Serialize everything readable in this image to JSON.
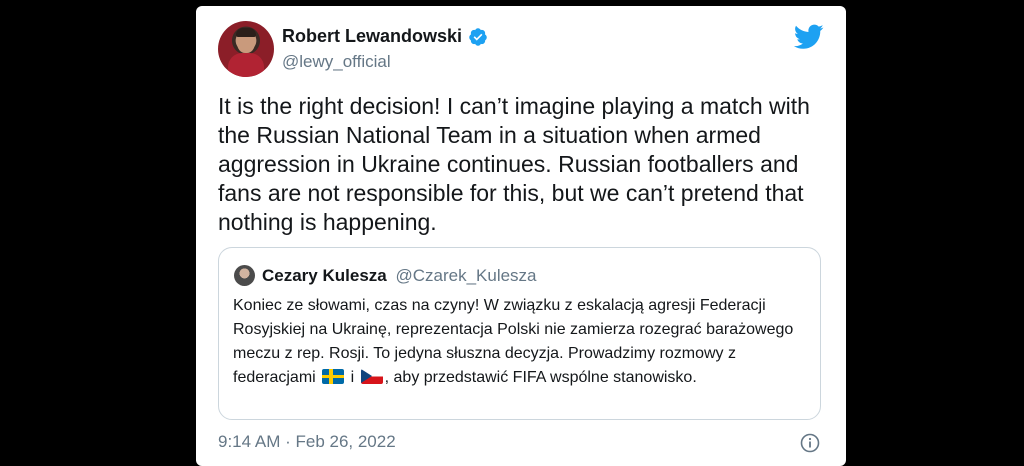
{
  "tweet": {
    "author_name": "Robert Lewandowski",
    "author_handle": "@lewy_official",
    "verified_icon": "verified-badge-icon",
    "brand_icon": "twitter-bird-icon",
    "text": "It is the right decision!  I can’t imagine playing a match with\nthe Russian National Team in a situation when armed\naggression in Ukraine continues.  Russian footballers and\nfans are not responsible for this, but we can’t pretend that\nnothing is happening.",
    "timestamp": "9:14 AM · Feb 26, 2022",
    "colors": {
      "accent": "#1da1f2",
      "text": "#14171a",
      "secondary": "#657786",
      "border": "#ccd6dd"
    }
  },
  "quoted": {
    "author_name": "Cezary Kulesza",
    "author_handle": "@Czarek_Kulesza",
    "text_part1": "Koniec ze słowami, czas na czyny! W związku z eskalacją agresji Federacji Rosyjskiej na Ukrainę, reprezentacja Polski nie zamierza rozegrać barażowego meczu z rep. Rosji. To jedyna słuszna decyzja. Prowadzimy rozmowy z federacjami",
    "text_between_flags": "i",
    "text_part2": ", aby przedstawić FIFA wspólne stanowisko.",
    "flags": [
      "sweden-flag-icon",
      "czech-flag-icon"
    ]
  }
}
